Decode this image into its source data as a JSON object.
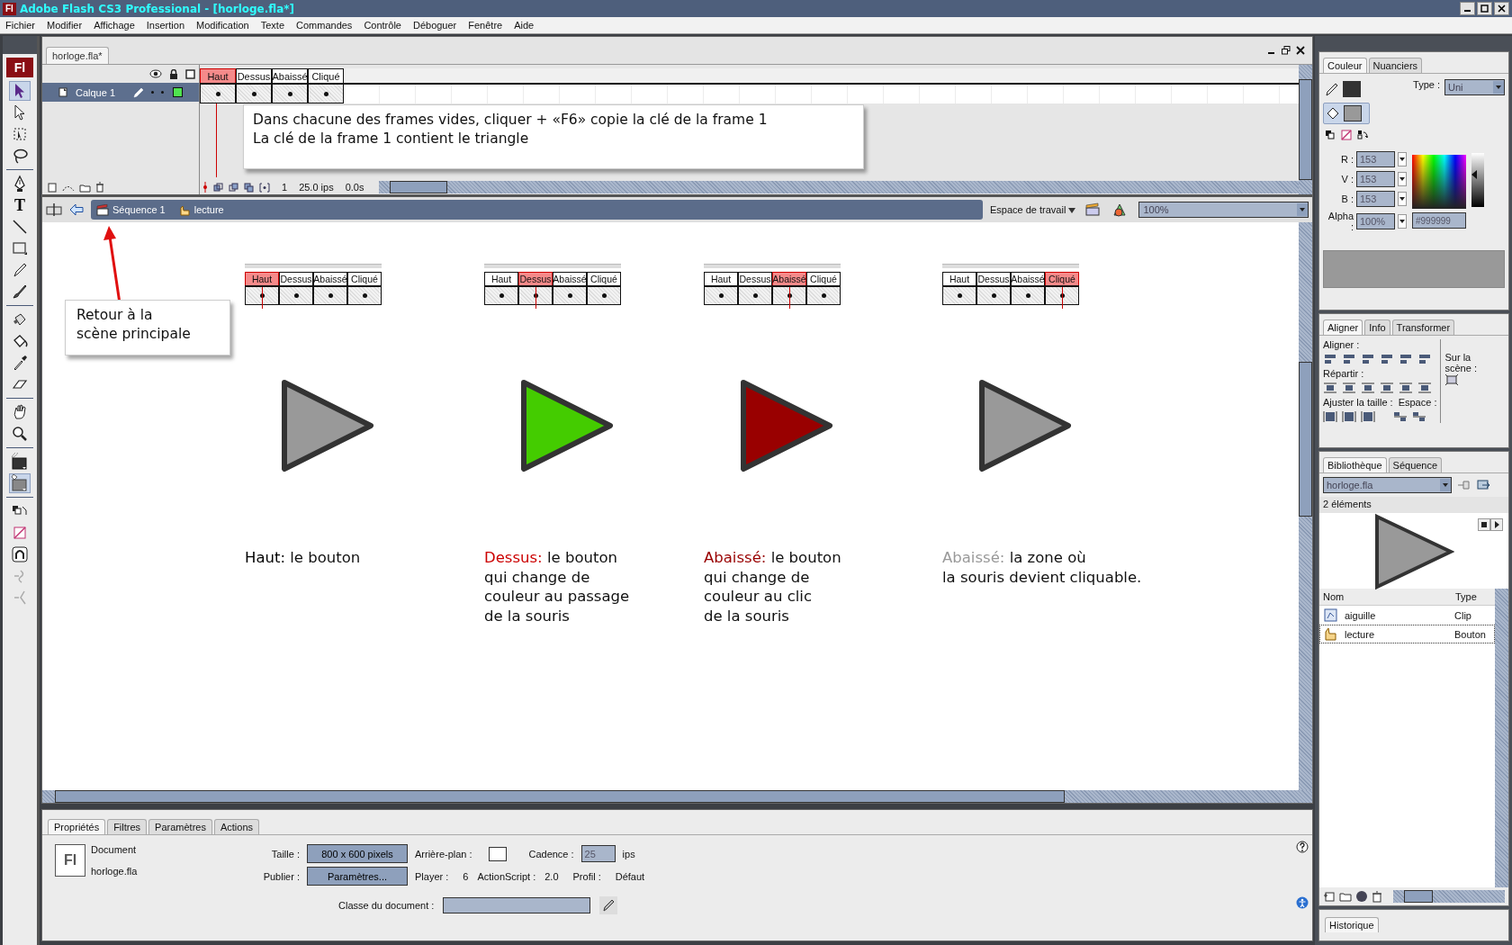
{
  "window": {
    "title": "Adobe Flash CS3 Professional - [horloge.fla*]",
    "logo": "Fl"
  },
  "menu": [
    "Fichier",
    "Modifier",
    "Affichage",
    "Insertion",
    "Modification",
    "Texte",
    "Commandes",
    "Contrôle",
    "Déboguer",
    "Fenêtre",
    "Aide"
  ],
  "toolbox": {
    "logo": "Fl",
    "tools": [
      {
        "kind": "pointer",
        "selected": true
      },
      {
        "kind": "subselect",
        "selected": false
      },
      {
        "kind": "transform",
        "selected": false
      },
      {
        "kind": "lasso",
        "selected": false
      },
      {
        "kind": "pen",
        "selected": false
      },
      {
        "kind": "text",
        "label": "T",
        "selected": false
      },
      {
        "kind": "line",
        "selected": false
      },
      {
        "kind": "rect",
        "selected": false
      },
      {
        "kind": "pencil",
        "selected": false
      },
      {
        "kind": "brush",
        "selected": false
      },
      {
        "kind": "inkbottle",
        "selected": false
      },
      {
        "kind": "bucket",
        "selected": false
      },
      {
        "kind": "eyedropper",
        "selected": false
      },
      {
        "kind": "eraser",
        "selected": false
      },
      {
        "kind": "hand",
        "selected": false
      },
      {
        "kind": "zoom",
        "selected": false
      },
      {
        "kind": "stroke",
        "selected": false
      },
      {
        "kind": "fill",
        "selected": true
      },
      {
        "kind": "swap",
        "selected": false
      },
      {
        "kind": "nocolor",
        "selected": false
      },
      {
        "kind": "snap",
        "selected": false
      },
      {
        "kind": "smooth",
        "selected": false
      },
      {
        "kind": "straighten",
        "selected": false
      }
    ]
  },
  "document": {
    "tab": "horloge.fla*",
    "timeline": {
      "layer": {
        "name": "Calque 1",
        "selected": true
      },
      "frames": [
        {
          "label": "Haut",
          "selected": true
        },
        {
          "label": "Dessus",
          "selected": false
        },
        {
          "label": "Abaissé",
          "selected": false
        },
        {
          "label": "Cliqué",
          "selected": false
        }
      ],
      "status": {
        "frame": "1",
        "rate": "25.0 ips",
        "time": "0.0s"
      },
      "note": [
        "Dans chacune des frames vides, cliquer + «F6» copie la clé de la frame 1",
        "La clé de la frame 1 contient le triangle"
      ]
    },
    "scene_bar": {
      "crumbs": [
        {
          "kind": "scene",
          "label": "Séquence 1"
        },
        {
          "kind": "symbol",
          "label": "lecture"
        }
      ],
      "workspace": "Espace de travail",
      "zoom": "100%"
    },
    "stage": {
      "callout": [
        "Retour à la",
        "scène principale"
      ],
      "states": [
        {
          "frames": [
            {
              "label": "Haut",
              "selected": true
            },
            {
              "label": "Dessus",
              "selected": false
            },
            {
              "label": "Abaissé",
              "selected": false
            },
            {
              "label": "Cliqué",
              "selected": false
            }
          ],
          "color": "#999999",
          "heading": {
            "text": "Haut:",
            "color": "#000000"
          },
          "lines": [
            "le bouton"
          ]
        },
        {
          "frames": [
            {
              "label": "Haut",
              "selected": false
            },
            {
              "label": "Dessus",
              "selected": true
            },
            {
              "label": "Abaissé",
              "selected": false
            },
            {
              "label": "Cliqué",
              "selected": false
            }
          ],
          "color": "#44cc00",
          "heading": {
            "text": "Dessus:",
            "color": "#cc0000"
          },
          "lines": [
            "le bouton",
            "qui change de",
            "couleur au passage",
            "de la souris"
          ]
        },
        {
          "frames": [
            {
              "label": "Haut",
              "selected": false
            },
            {
              "label": "Dessus",
              "selected": false
            },
            {
              "label": "Abaissé",
              "selected": true
            },
            {
              "label": "Cliqué",
              "selected": false
            }
          ],
          "color": "#990000",
          "heading": {
            "text": "Abaissé:",
            "color": "#990000"
          },
          "lines": [
            "le bouton",
            "qui change de",
            "couleur au clic",
            "de la souris"
          ]
        },
        {
          "frames": [
            {
              "label": "Haut",
              "selected": false
            },
            {
              "label": "Dessus",
              "selected": false
            },
            {
              "label": "Abaissé",
              "selected": false
            },
            {
              "label": "Cliqué",
              "selected": true
            }
          ],
          "color": "#999999",
          "heading": {
            "text": "Abaissé:",
            "color": "#999999"
          },
          "lines": [
            "la zone où",
            "la souris devient cliquable."
          ]
        }
      ]
    }
  },
  "properties": {
    "tabs": [
      {
        "label": "Propriétés",
        "selected": true
      },
      {
        "label": "Filtres",
        "selected": false
      },
      {
        "label": "Paramètres",
        "selected": false
      },
      {
        "label": "Actions",
        "selected": false
      }
    ],
    "icon": "Fl",
    "type": "Document",
    "file": "horloge.fla",
    "size_label": "Taille :",
    "size": "800 x 600 pixels",
    "publish_label": "Publier :",
    "publish": "Paramètres...",
    "background_label": "Arrière-plan :",
    "rate_label": "Cadence :",
    "rate": "25",
    "rate_unit": "ips",
    "player_label": "Player :",
    "player": "6",
    "as_label": "ActionScript :",
    "as": "2.0",
    "profile_label": "Profil :",
    "profile": "Défaut",
    "class_label": "Classe du document :"
  },
  "color_panel": {
    "tabs": [
      {
        "label": "Couleur",
        "selected": true
      },
      {
        "label": "Nuanciers",
        "selected": false
      }
    ],
    "type_label": "Type :",
    "type": "Uni",
    "channels": [
      {
        "label": "R :",
        "value": "153"
      },
      {
        "label": "V :",
        "value": "153"
      },
      {
        "label": "B :",
        "value": "153"
      },
      {
        "label": "Alpha :",
        "value": "100%"
      }
    ],
    "color": "#999999",
    "brightness": {
      "level": 0.6
    }
  },
  "align_panel": {
    "tabs": [
      {
        "label": "Aligner",
        "selected": true
      },
      {
        "label": "Info",
        "selected": false
      },
      {
        "label": "Transformer",
        "selected": false
      }
    ],
    "align": "Aligner :",
    "distribute": "Répartir :",
    "match": "Ajuster la taille :",
    "space": "Espace :",
    "stage": [
      "Sur la",
      "scène :"
    ]
  },
  "library": {
    "tabs": [
      {
        "label": "Bibliothèque",
        "selected": true
      },
      {
        "label": "Séquence",
        "selected": false
      }
    ],
    "file": "horloge.fla",
    "count": "2 éléments",
    "columns": [
      "Nom",
      "Type"
    ],
    "items": [
      {
        "kind": "clip",
        "name": "aiguille",
        "type": "Clip",
        "selected": false
      },
      {
        "kind": "button",
        "name": "lecture",
        "type": "Bouton",
        "selected": true
      }
    ]
  },
  "history": {
    "tab": "Historique"
  }
}
